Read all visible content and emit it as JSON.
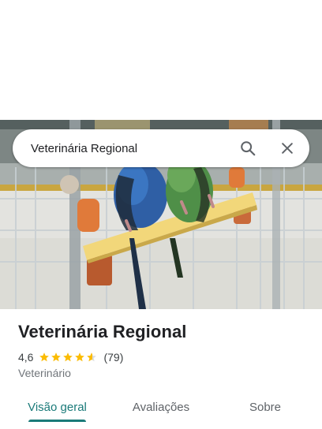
{
  "search": {
    "query": "Veterinária Regional",
    "search_icon": "search-icon",
    "close_icon": "close-icon"
  },
  "hero": {
    "description_icon": "place-photo"
  },
  "place": {
    "name": "Veterinária Regional",
    "rating": "4,6",
    "rating_value": 4.6,
    "stars_max": 5,
    "review_count": "(79)",
    "category": "Veterinário"
  },
  "tabs": [
    {
      "label": "Visão geral",
      "active": true
    },
    {
      "label": "Avaliações",
      "active": false
    },
    {
      "label": "Sobre",
      "active": false
    }
  ],
  "colors": {
    "accent": "#1a7a79",
    "star": "#fbbc04",
    "star_empty": "#dadce0"
  }
}
